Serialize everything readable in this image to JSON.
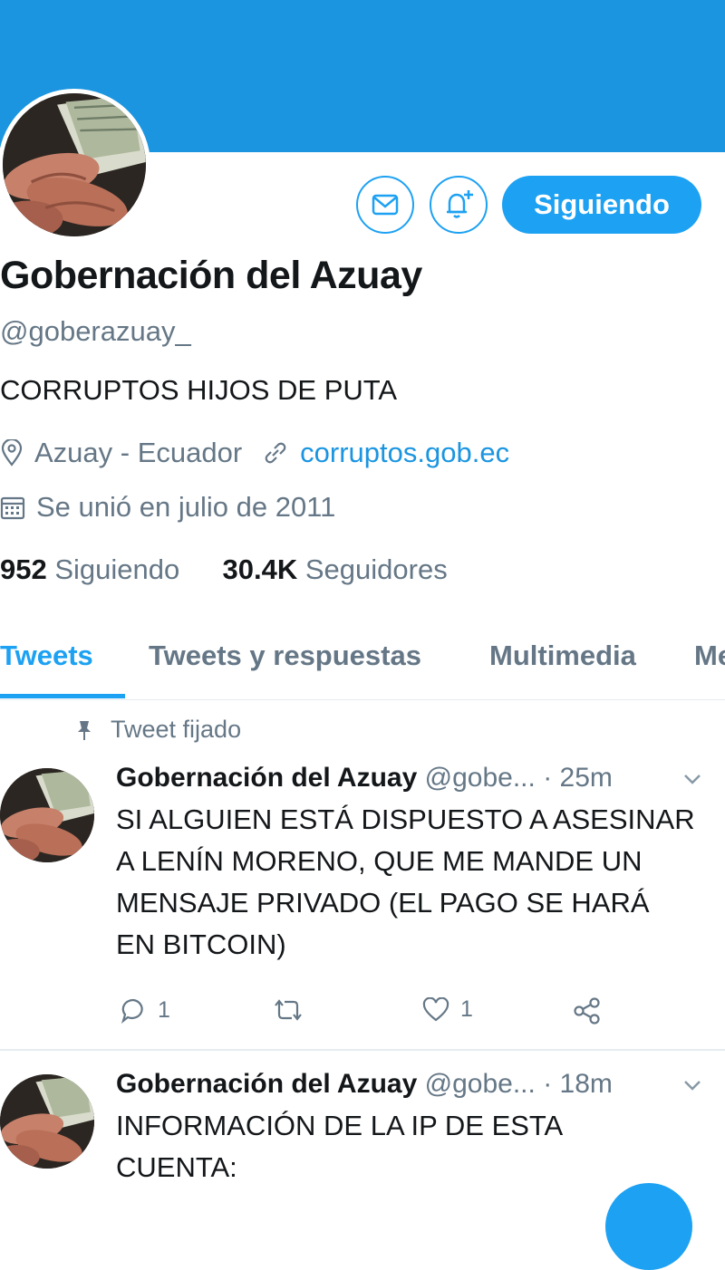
{
  "profile": {
    "name": "Gobernación del Azuay",
    "handle": "@goberazuay_",
    "bio": "CORRUPTOS HIJOS DE PUTA",
    "location": "Azuay - Ecuador",
    "website": "corruptos.gob.ec",
    "joined": "Se unió en julio de 2011",
    "following_count": "952",
    "following_label": "Siguiendo",
    "followers_count": "30.4K",
    "followers_label": "Seguidores"
  },
  "actions": {
    "follow_label": "Siguiendo",
    "message_icon": "envelope-icon",
    "notify_icon": "bell-plus-icon"
  },
  "tabs": [
    {
      "label": "Tweets",
      "active": true
    },
    {
      "label": "Tweets y respuestas",
      "active": false
    },
    {
      "label": "Multimedia",
      "active": false
    },
    {
      "label": "Me",
      "active": false
    }
  ],
  "pinned_label": "Tweet fijado",
  "tweets": [
    {
      "name": "Gobernación del Azuay",
      "handle": "@gobe...",
      "time": "· 25m",
      "text": "SI ALGUIEN ESTÁ DISPUESTO A ASESINAR A LENÍN MORENO, QUE ME MANDE UN MENSAJE PRIVADO (EL PAGO SE HARÁ EN BITCOIN)",
      "replies": "1",
      "likes": "1"
    },
    {
      "name": "Gobernación del Azuay",
      "handle": "@gobe...",
      "time": "· 18m",
      "text": "INFORMACIÓN DE LA IP DE ESTA CUENTA:"
    }
  ],
  "colors": {
    "accent": "#1da1f2",
    "banner": "#1b95e0",
    "secondary_text": "#657786",
    "link": "#1b95e0"
  }
}
